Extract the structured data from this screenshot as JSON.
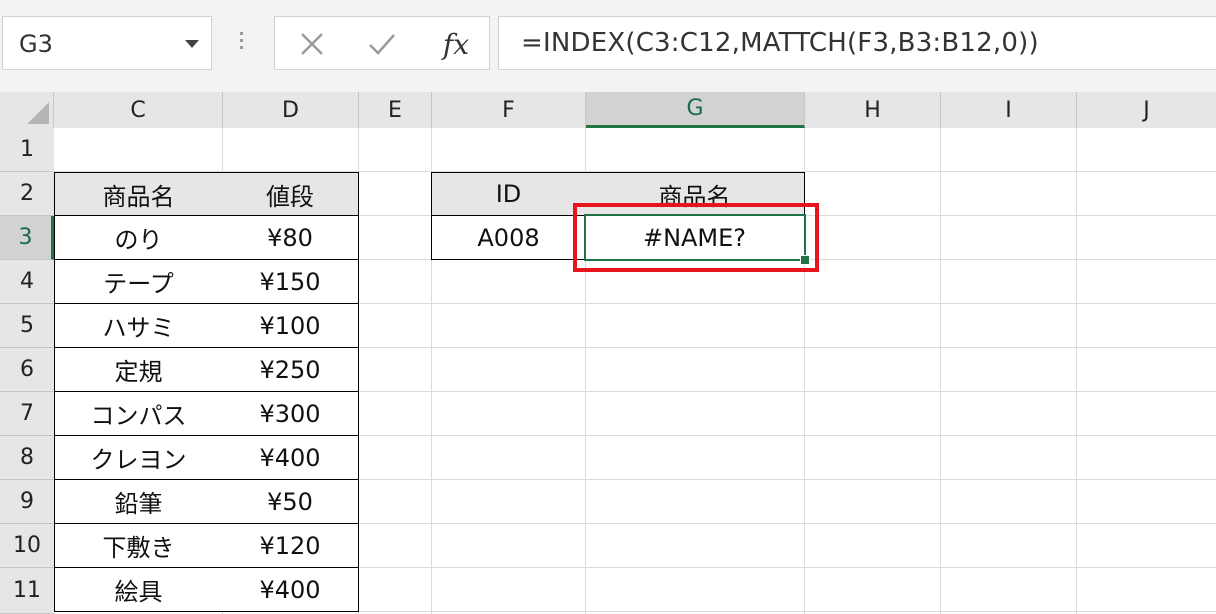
{
  "name_box": {
    "value": "G3"
  },
  "formula_bar": {
    "formula": "=INDEX(C3:C12,MATTCH(F3,B3:B12,0))",
    "fx_label": "fx"
  },
  "columns": [
    "C",
    "D",
    "E",
    "F",
    "G",
    "H",
    "I",
    "J"
  ],
  "active_column": "G",
  "rows": [
    "1",
    "2",
    "3",
    "4",
    "5",
    "6",
    "7",
    "8",
    "9",
    "10",
    "11"
  ],
  "active_row": "3",
  "product_table": {
    "headers": [
      "商品名",
      "値段"
    ],
    "rows": [
      [
        "のり",
        "¥80"
      ],
      [
        "テープ",
        "¥150"
      ],
      [
        "ハサミ",
        "¥100"
      ],
      [
        "定規",
        "¥250"
      ],
      [
        "コンパス",
        "¥300"
      ],
      [
        "クレヨン",
        "¥400"
      ],
      [
        "鉛筆",
        "¥50"
      ],
      [
        "下敷き",
        "¥120"
      ],
      [
        "絵具",
        "¥400"
      ]
    ]
  },
  "lookup_table": {
    "headers": [
      "ID",
      "商品名"
    ],
    "id_value": "A008",
    "result_value": "#NAME?"
  },
  "colors": {
    "accent": "#217346",
    "highlight": "#e8141b",
    "header_fill": "#e7e6e6"
  }
}
